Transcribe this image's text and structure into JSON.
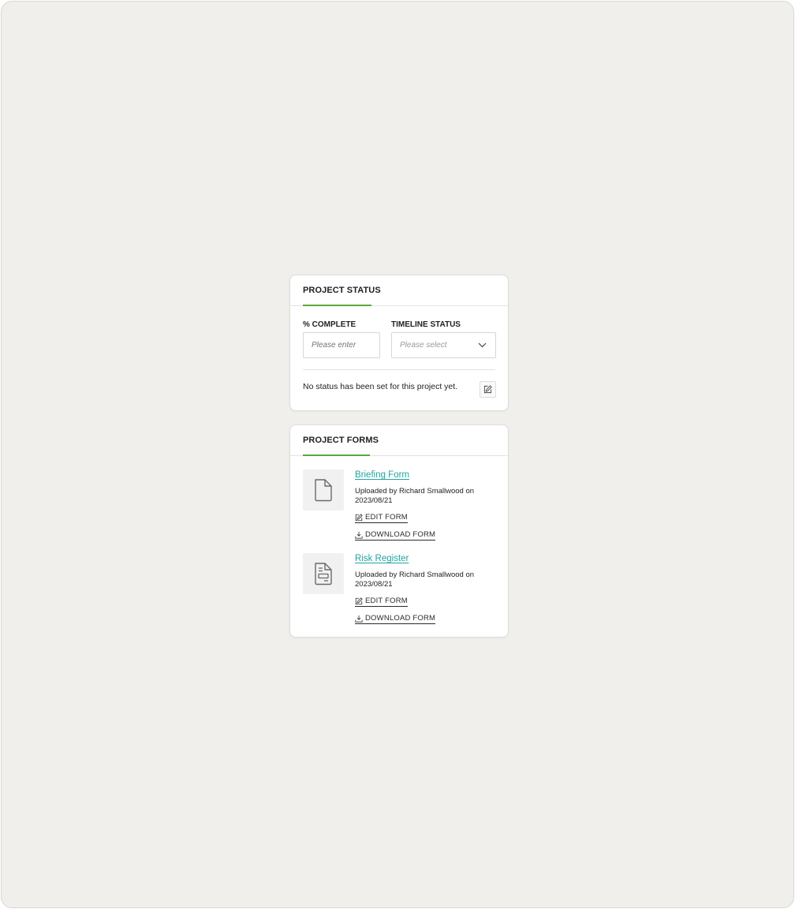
{
  "project_status": {
    "title": "PROJECT STATUS",
    "percent_complete": {
      "label": "% COMPLETE",
      "placeholder": "Please enter",
      "value": ""
    },
    "timeline_status": {
      "label": "TIMELINE STATUS",
      "placeholder": "Please select"
    },
    "message": "No status has been set for this project yet.",
    "edit_icon": "pencil-square-icon"
  },
  "project_forms": {
    "title": "PROJECT FORMS",
    "forms": [
      {
        "name": "Briefing Form",
        "meta": "Uploaded by Richard Smallwood on 2023/08/21",
        "icon": "document-icon",
        "edit_label": "EDIT FORM",
        "download_label": "DOWNLOAD FORM"
      },
      {
        "name": "Risk Register",
        "meta": "Uploaded by Richard Smallwood on 2023/08/21",
        "icon": "register-document-icon",
        "edit_label": "EDIT FORM",
        "download_label": "DOWNLOAD FORM"
      }
    ]
  },
  "colors": {
    "accent_green": "#5aa83a",
    "link_teal": "#1fa5a0",
    "background": "#f0efeb"
  }
}
